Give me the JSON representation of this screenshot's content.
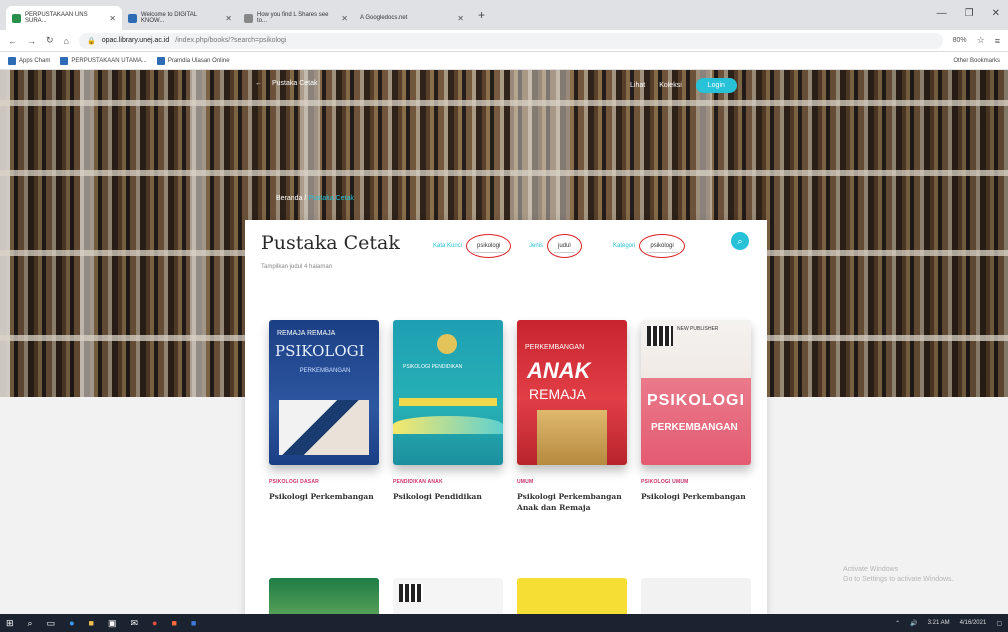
{
  "browser": {
    "tabs": [
      {
        "label": "PERPUSTAKAAN UNS SURA...",
        "active": true
      },
      {
        "label": "Welcome to DIGITAL KNOW...",
        "active": false
      },
      {
        "label": "How you find L Shares see to...",
        "active": false
      },
      {
        "label": "A  Googledocs.net",
        "active": false
      }
    ],
    "new_tab": "+",
    "window_controls": [
      "—",
      "❐",
      "✕"
    ],
    "nav": [
      "←",
      "→",
      "↻",
      "⌂"
    ],
    "url_host": "opac.library.unej.ac.id",
    "url_path": "/index.php/books/?search=psikologi",
    "zoom": "80%",
    "bookmarks": [
      "Apps Cham",
      "PERPUSTAKAAN UTAMA...",
      "Pramdia Ulasan Online"
    ],
    "bookmarks_right": "Other Bookmarks"
  },
  "hero": {
    "back_label": "Pustaka Cetak",
    "nav_right": [
      "Lihat",
      "Koleksi",
      "Login"
    ],
    "breadcrumb_home": "Beranda",
    "breadcrumb_current": "Pustaka Cetak"
  },
  "card": {
    "title": "Pustaka Cetak",
    "subtitle": "Tampilkan judul 4 halaman",
    "filters": [
      {
        "label": "Kata Kunci",
        "value": "psikologi"
      },
      {
        "label": "Jenis",
        "value": "judul"
      },
      {
        "label": "Kategori",
        "value": "psikologi"
      }
    ],
    "search_icon": "search-icon"
  },
  "books": [
    {
      "category": "PSIKOLOGI DASAR",
      "title": "Psikologi Perkembangan",
      "cover": {
        "top": "REMAJA REMAJA",
        "main": "PSIKOLOGI",
        "sub": "PERKEMBANGAN"
      }
    },
    {
      "category": "PENDIDIKAN ANAK",
      "title": "Psikologi Pendidikan",
      "cover": {
        "text": "PSIKOLOGI PENDIDIKAN"
      }
    },
    {
      "category": "UMUM",
      "title": "Psikologi Perkembangan Anak dan Remaja",
      "cover": {
        "top": "PERKEMBANGAN",
        "main": "ANAK",
        "sub": "REMAJA"
      }
    },
    {
      "category": "PSIKOLOGI UMUM",
      "title": "Psikologi Perkembangan",
      "cover": {
        "top": "NEW PUBLISHER",
        "main": "PSIKOLOGI",
        "sub": "PERKEMBANGAN"
      }
    }
  ],
  "watermark": {
    "line1": "Activate Windows",
    "line2": "Go to Settings to activate Windows."
  },
  "taskbar": {
    "tray_time": "3:21 AM",
    "tray_date": "4/16/2021"
  },
  "colors": {
    "accent": "#27c2d8",
    "category": "#d0316b",
    "annotation": "#dd2222"
  }
}
